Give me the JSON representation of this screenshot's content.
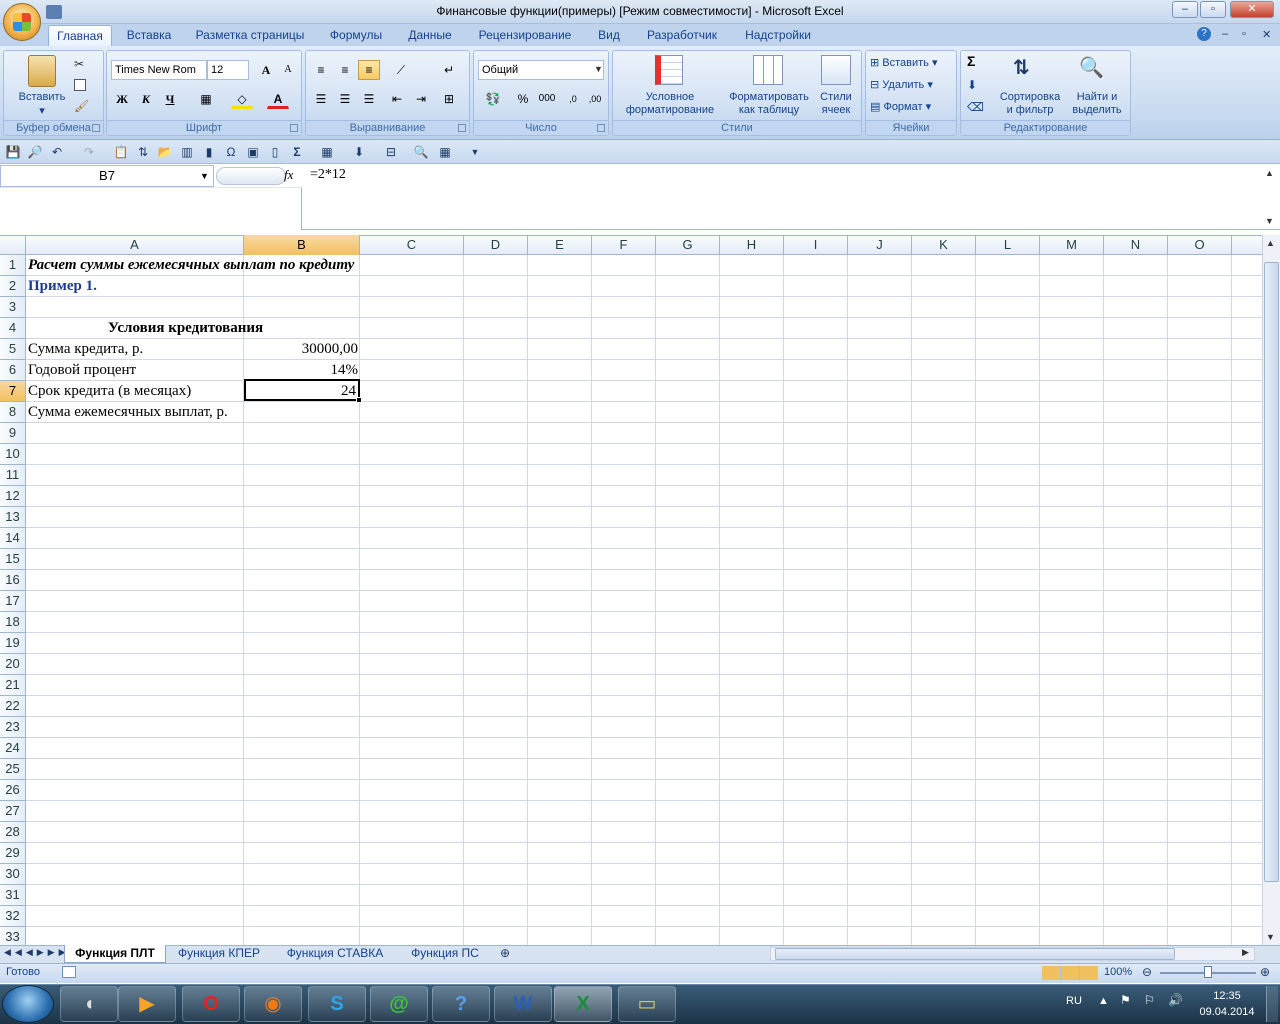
{
  "window": {
    "title": "Финансовые функции(примеры)  [Режим совместимости] - Microsoft Excel",
    "minimize": "–",
    "maximize": "▫",
    "close": "✕"
  },
  "tabs": [
    "Главная",
    "Вставка",
    "Разметка страницы",
    "Формулы",
    "Данные",
    "Рецензирование",
    "Вид",
    "Разработчик",
    "Надстройки"
  ],
  "ribbon": {
    "clipboard": {
      "label": "Буфер обмена",
      "paste": "Вставить"
    },
    "font": {
      "label": "Шрифт",
      "name": "Times New Rom",
      "size": "12",
      "bold": "Ж",
      "italic": "К",
      "underline": "Ч",
      "grow": "A",
      "shrink": "A",
      "fontcolor": "A"
    },
    "alignment": {
      "label": "Выравнивание"
    },
    "number": {
      "label": "Число",
      "format": "Общий",
      "percent": "%",
      "thousands": "000",
      "inc": ",0",
      "dec": ",00"
    },
    "styles": {
      "label": "Стили",
      "cond1": "Условное",
      "cond2": "форматирование",
      "table1": "Форматировать",
      "table2": "как таблицу",
      "cell1": "Стили",
      "cell2": "ячеек"
    },
    "cells": {
      "label": "Ячейки",
      "insert": "Вставить",
      "delete": "Удалить",
      "format": "Формат"
    },
    "editing": {
      "label": "Редактирование",
      "sum": "Σ",
      "sort1": "Сортировка",
      "sort2": "и фильтр",
      "find1": "Найти и",
      "find2": "выделить"
    }
  },
  "formula_bar": {
    "name_box": "B7",
    "fx": "fx",
    "formula": "=2*12"
  },
  "columns": [
    "A",
    "B",
    "C",
    "D",
    "E",
    "F",
    "G",
    "H",
    "I",
    "J",
    "K",
    "L",
    "M",
    "N",
    "O"
  ],
  "rows": [
    "1",
    "2",
    "3",
    "4",
    "5",
    "6",
    "7",
    "8",
    "9",
    "10",
    "11",
    "12",
    "13",
    "14",
    "15",
    "16",
    "17",
    "18",
    "19",
    "20",
    "21",
    "22",
    "23",
    "24",
    "25",
    "26",
    "27",
    "28",
    "29",
    "30",
    "31",
    "32",
    "33"
  ],
  "cells": {
    "A1": "Расчет суммы ежемесячных выплат по кредиту",
    "A2": "Пример 1.",
    "A4": "Условия кредитования",
    "A5": "Сумма кредита, р.",
    "B5": "30000,00",
    "A6": "Годовой процент",
    "B6": "14%",
    "A7": "Срок кредита (в месяцах)",
    "B7": "24",
    "A8": "Сумма ежемесячных выплат, р."
  },
  "sheets": [
    "Функция ПЛТ",
    "Функция КПЕР",
    "Функция СТАВКА",
    "Функция ПС"
  ],
  "active_sheet": "Функция ПЛТ",
  "status": {
    "ready": "Готово",
    "zoom": "100%"
  },
  "taskbar": {
    "lang": "RU",
    "time": "12:35",
    "date": "09.04.2014"
  },
  "colors": {
    "accent": "#15428b",
    "selection": "#f1c15f",
    "ribbon": "#c9dbf1"
  }
}
